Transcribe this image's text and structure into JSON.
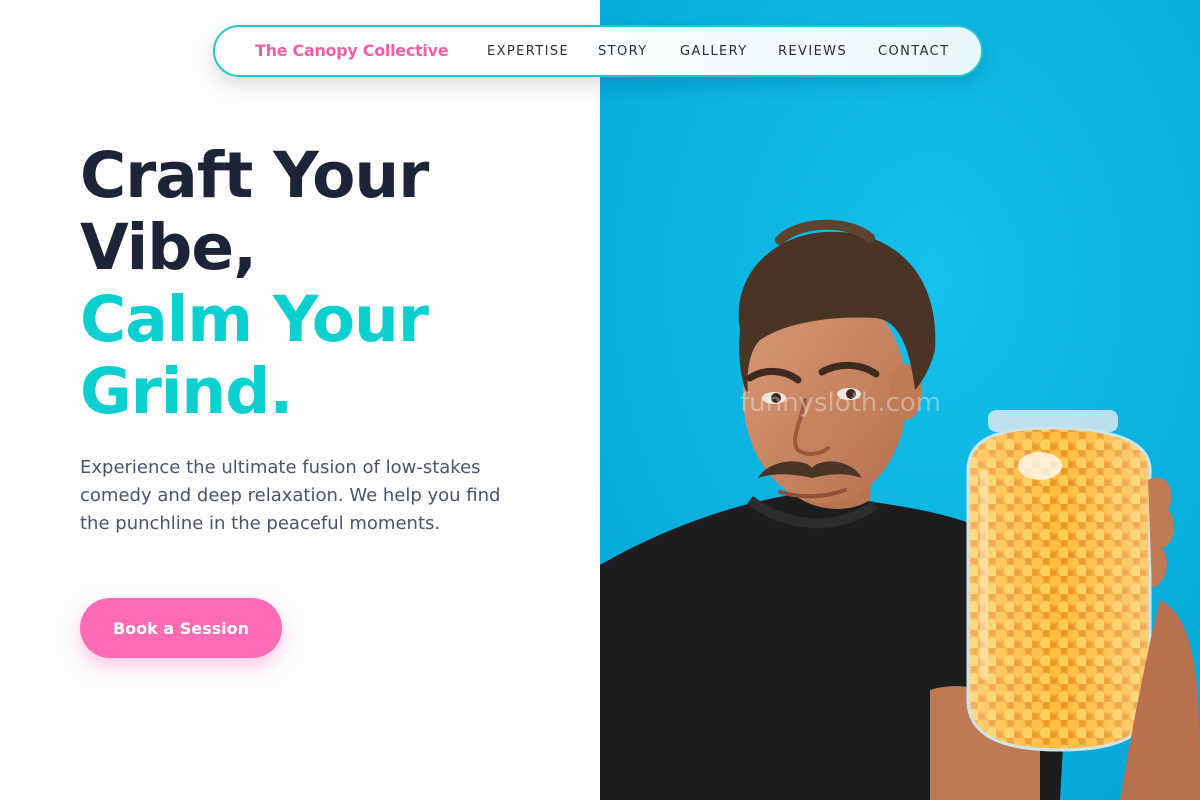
{
  "nav": {
    "brand": "The Canopy Collective",
    "links": [
      "EXPERTISE",
      "STORY",
      "GALLERY",
      "REVIEWS",
      "CONTACT"
    ]
  },
  "hero": {
    "headline_line1": "Craft Your",
    "headline_line2": "Vibe,",
    "headline_line3": "Calm Your",
    "headline_line4": "Grind.",
    "description": "Experience the ultimate fusion of low-stakes comedy and deep relaxation. We help you find the punchline in the peaceful moments.",
    "cta_label": "Book a Session"
  },
  "photo": {
    "subject": "man with mustache holding a jar of orange cheese puffs",
    "watermark": "funnysloth.com"
  },
  "colors": {
    "brand_pink": "#f25fa8",
    "cta_pink": "#ff6bb5",
    "accent_teal": "#0ccfcf",
    "headline_dark": "#1c2437",
    "photo_background": "#06b2e0"
  }
}
